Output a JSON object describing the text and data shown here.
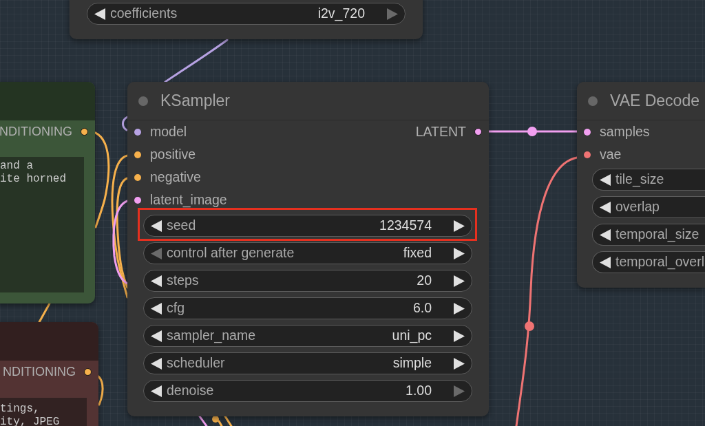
{
  "nodes": [
    {
      "kind": "widget_panel",
      "color": "#353535",
      "widgets": [
        {
          "label": "coefficients",
          "value": "i2v_720",
          "left_disabled": false,
          "right_disabled": true,
          "highlighted": false
        }
      ]
    },
    {
      "kind": "prompt",
      "color": "#3c5639",
      "outputs": [
        {
          "label": "NDITIONING",
          "color": "#f7b14c"
        }
      ],
      "text_lines": [
        "and a",
        "ite horned"
      ]
    },
    {
      "kind": "prompt",
      "color": "#533333",
      "outputs": [
        {
          "label": "NDITIONING",
          "color": "#f7b14c"
        }
      ],
      "text_lines": [
        "tings,",
        "ity, JPEG"
      ]
    },
    {
      "kind": "standard",
      "color": "#353535",
      "title": "KSampler",
      "inputs": [
        {
          "label": "model",
          "color": "#b7a2e3"
        },
        {
          "label": "positive",
          "color": "#f7b14c"
        },
        {
          "label": "negative",
          "color": "#f7b14c"
        },
        {
          "label": "latent_image",
          "color": "#f19ff0"
        }
      ],
      "outputs": [
        {
          "label": "LATENT",
          "color": "#f19ff0"
        }
      ],
      "widgets": [
        {
          "label": "seed",
          "value": "1234574",
          "left_disabled": false,
          "right_disabled": false,
          "highlighted": true
        },
        {
          "label": "control after generate",
          "value": "fixed",
          "left_disabled": true,
          "right_disabled": false,
          "highlighted": false
        },
        {
          "label": "steps",
          "value": "20",
          "left_disabled": false,
          "right_disabled": false,
          "highlighted": false
        },
        {
          "label": "cfg",
          "value": "6.0",
          "left_disabled": false,
          "right_disabled": false,
          "highlighted": false
        },
        {
          "label": "sampler_name",
          "value": "uni_pc",
          "left_disabled": false,
          "right_disabled": false,
          "highlighted": false
        },
        {
          "label": "scheduler",
          "value": "simple",
          "left_disabled": false,
          "right_disabled": false,
          "highlighted": false
        },
        {
          "label": "denoise",
          "value": "1.00",
          "left_disabled": false,
          "right_disabled": true,
          "highlighted": false
        }
      ]
    },
    {
      "kind": "standard",
      "color": "#353535",
      "title": "VAE Decode",
      "inputs": [
        {
          "label": "samples",
          "color": "#f19ff0"
        },
        {
          "label": "vae",
          "color": "#ef7373"
        }
      ],
      "widgets": [
        {
          "label": "tile_size",
          "left_disabled": false,
          "highlighted": false
        },
        {
          "label": "overlap",
          "left_disabled": false,
          "highlighted": false
        },
        {
          "label": "temporal_size",
          "left_disabled": false,
          "highlighted": false
        },
        {
          "label": "temporal_overl",
          "left_disabled": false,
          "highlighted": false
        }
      ]
    }
  ]
}
